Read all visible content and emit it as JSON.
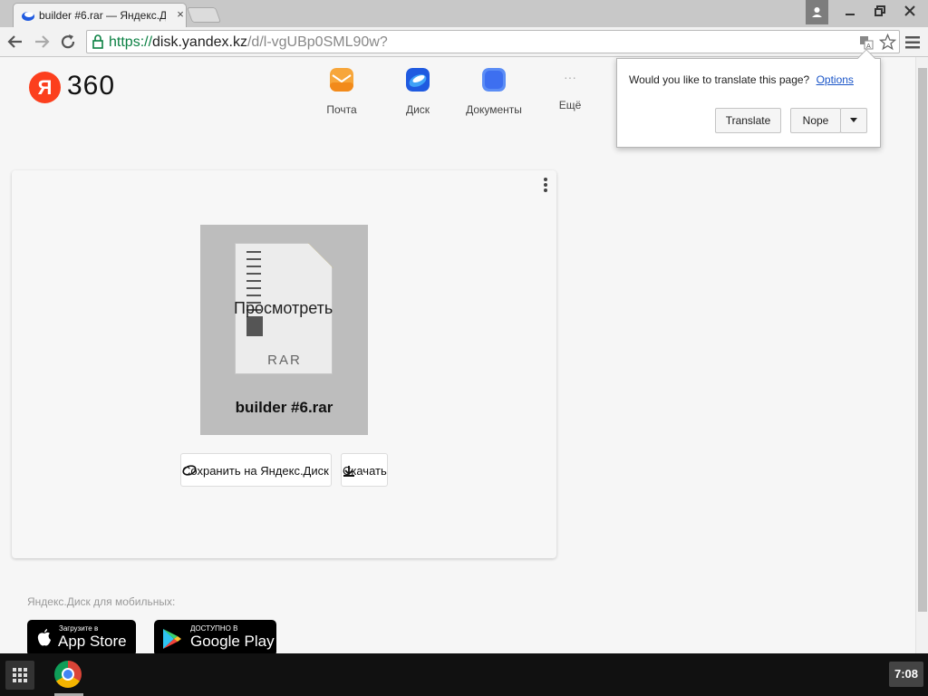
{
  "browser": {
    "tab_title": "builder #6.rar — Яндекс.Д",
    "tab_close": "×",
    "url_scheme": "https://",
    "url_host": "disk.yandex.kz",
    "url_path": "/d/l-vgUBp0SML90w?"
  },
  "header": {
    "logo_ya": "Я",
    "logo_360": "360",
    "services": [
      {
        "label": "Почта",
        "color": "#f7a63a"
      },
      {
        "label": "Диск",
        "color": "#1f5ae0"
      },
      {
        "label": "Документы",
        "color": "#3d7bf2"
      },
      {
        "label": "Ещё",
        "icon": "more-dots-icon"
      }
    ],
    "more_glyph": "···"
  },
  "file_card": {
    "type_label": "RAR",
    "preview_text": "Просмотреть",
    "file_name": "builder #6.rar",
    "save_button": "Сохранить на Яндекс.Диск",
    "download_button": "Скачать"
  },
  "mobile": {
    "label": "Яндекс.Диск для мобильных:",
    "app_store_small": "Загрузите в",
    "app_store_big": "App Store",
    "google_play_small": "ДОСТУПНО В",
    "google_play_big": "Google Play"
  },
  "translate_bubble": {
    "question": "Would you like to translate this page?",
    "options_link": "Options",
    "translate_button": "Translate",
    "nope_button": "Nope"
  },
  "taskbar": {
    "clock": "7:08"
  },
  "colors": {
    "yandex_red": "#fc3f1d",
    "secure_green": "#0b8043",
    "link_blue": "#1a55c8"
  }
}
